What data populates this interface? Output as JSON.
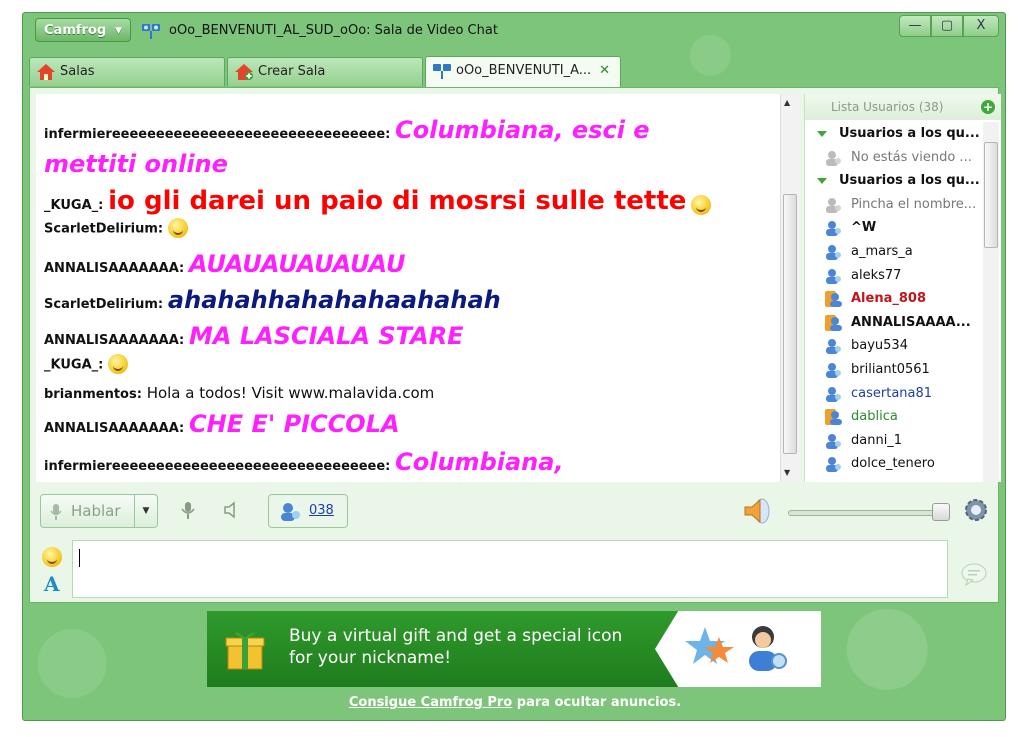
{
  "window": {
    "menu_button": "Camfrog",
    "title": "oOo_BENVENUTI_AL_SUD_oOo: Sala de Video Chat",
    "controls": {
      "minimize": "—",
      "maximize": "▢",
      "close": "X"
    }
  },
  "tabs": [
    {
      "label": "Salas"
    },
    {
      "label": "Crear Sala"
    },
    {
      "label": "oOo_BENVENUTI_A...",
      "close": "✕"
    }
  ],
  "chat": {
    "messages": [
      {
        "nick": "infermiereeeeeeeeeeeeeeeeeeeeeeeeeeeeeee:",
        "text": "Columbiana, esci e",
        "text2": "mettiti online"
      },
      {
        "nick": "_KUGA_:",
        "text": "io gli darei un paio di mosrsi sulle tette"
      },
      {
        "nick": "ScarletDelirium:",
        "text": ""
      },
      {
        "nick": "ANNALISAAAAAAA:",
        "text": "AUAUAUAUAUAU"
      },
      {
        "nick": "ScarletDelirium:",
        "text": "ahahahhahahahaahahah"
      },
      {
        "nick": "ANNALISAAAAAAA:",
        "text": "MA LASCIALA STARE"
      },
      {
        "nick": "_KUGA_:",
        "text": ""
      },
      {
        "nick": "brianmentos:",
        "text": "Hola a todos! Visit www.malavida.com"
      },
      {
        "nick": "ANNALISAAAAAAA:",
        "text": "CHE E' PICCOLA"
      },
      {
        "nick": "infermiereeeeeeeeeeeeeeeeeeeeeeeeeeeeeee:",
        "text": "Columbiana,"
      }
    ]
  },
  "users": {
    "header": "Lista Usuarios (38)",
    "add": "+",
    "groups": [
      {
        "label": "Usuarios a los qu...",
        "hint": "No estás viendo ..."
      },
      {
        "label": "Usuarios a los qu...",
        "hint": "Pincha el nombre..."
      }
    ],
    "list": [
      {
        "name": "^W"
      },
      {
        "name": "a_mars_a"
      },
      {
        "name": "aleks77"
      },
      {
        "name": "Alena_808"
      },
      {
        "name": "ANNALISAAAA..."
      },
      {
        "name": "bayu534"
      },
      {
        "name": "briliant0561"
      },
      {
        "name": "casertana81"
      },
      {
        "name": "dablica"
      },
      {
        "name": "danni_1"
      },
      {
        "name": "dolce_tenero"
      }
    ]
  },
  "toolbar": {
    "talk_label": "Hablar",
    "viewers": "038"
  },
  "input": {
    "value": ""
  },
  "ad": {
    "line1": "Buy a virtual gift and get a special icon",
    "line2": "for your nickname!",
    "pro_link": "Consigue Camfrog Pro",
    "pro_rest": " para ocultar anuncios."
  },
  "colors": {
    "frame": "#7dc57a",
    "magenta": "#ff1fff",
    "red": "#ff0000",
    "navy": "#0b1a80"
  }
}
